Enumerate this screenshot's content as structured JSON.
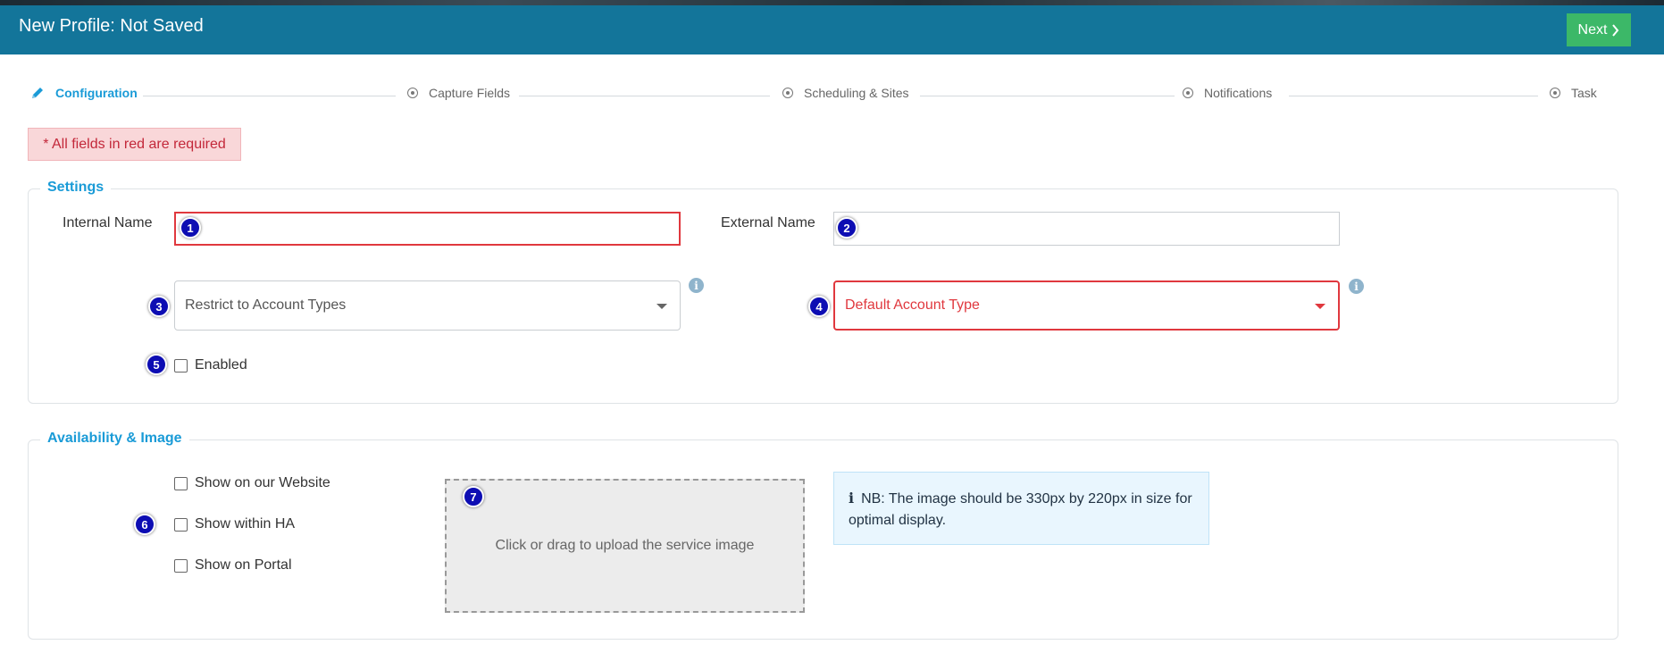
{
  "header": {
    "title": "New Profile: Not Saved",
    "next_label": "Next",
    "next_icon": "chevron-right-icon",
    "bg_color": "#13759a",
    "next_color": "#3cb868"
  },
  "steps": [
    {
      "label": "Configuration",
      "icon": "pencil-icon",
      "active": true
    },
    {
      "label": "Capture Fields",
      "icon": "radio-dot-icon",
      "active": false
    },
    {
      "label": "Scheduling & Sites",
      "icon": "radio-dot-icon",
      "active": false
    },
    {
      "label": "Notifications",
      "icon": "radio-dot-icon",
      "active": false
    },
    {
      "label": "Task",
      "icon": "radio-dot-icon",
      "active": false
    }
  ],
  "alert": {
    "text": "* All fields in red are required"
  },
  "settings": {
    "legend": "Settings",
    "internal_name_label": "Internal Name",
    "internal_name_value": "",
    "external_name_label": "External Name",
    "external_name_value": "",
    "restrict_account_types_placeholder": "Restrict to Account Types",
    "default_account_type_placeholder": "Default Account Type",
    "enabled_label": "Enabled",
    "enabled_checked": false
  },
  "availability": {
    "legend": "Availability & Image",
    "show_website_label": "Show on our Website",
    "show_ha_label": "Show within HA",
    "show_portal_label": "Show on Portal",
    "upload_text": "Click or drag to upload the service image",
    "note_text": "NB: The image should be 330px by 220px in size for optimal display."
  },
  "badges": [
    "1",
    "2",
    "3",
    "4",
    "5",
    "6",
    "7"
  ],
  "colors": {
    "accent": "#1a9bd7",
    "required": "#e0383e",
    "badge": "#0d0db3"
  }
}
